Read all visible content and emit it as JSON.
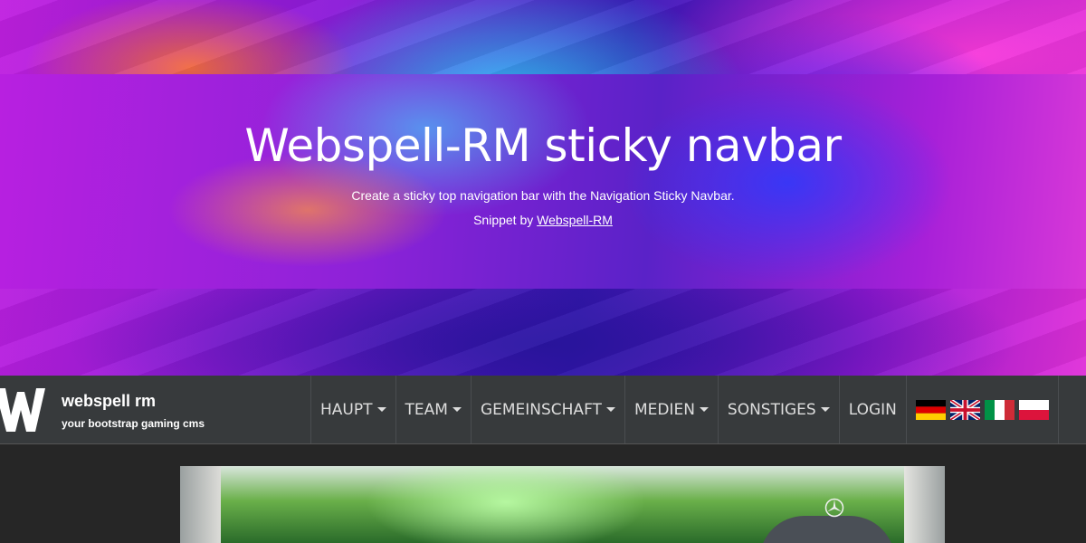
{
  "hero": {
    "title": "Webspell-RM sticky navbar",
    "subtitle": "Create a sticky top navigation bar with the Navigation Sticky Navbar.",
    "credit_prefix": "Snippet by ",
    "credit_link": "Webspell-RM"
  },
  "brand": {
    "name": "webspell rm",
    "tagline": "your bootstrap gaming cms",
    "logo_icon": "w-logo-icon"
  },
  "nav": {
    "items": [
      {
        "label": "HAUPT",
        "dropdown": true
      },
      {
        "label": "TEAM",
        "dropdown": true
      },
      {
        "label": "GEMEINSCHAFT",
        "dropdown": true
      },
      {
        "label": "MEDIEN",
        "dropdown": true
      },
      {
        "label": "SONSTIGES",
        "dropdown": true
      },
      {
        "label": "LOGIN",
        "dropdown": false
      }
    ],
    "languages": [
      "german-flag-icon",
      "uk-flag-icon",
      "italian-flag-icon",
      "polish-flag-icon"
    ]
  },
  "colors": {
    "navbar_bg": "#373a3c",
    "page_bg": "#262626",
    "nav_text": "#dddddd"
  }
}
